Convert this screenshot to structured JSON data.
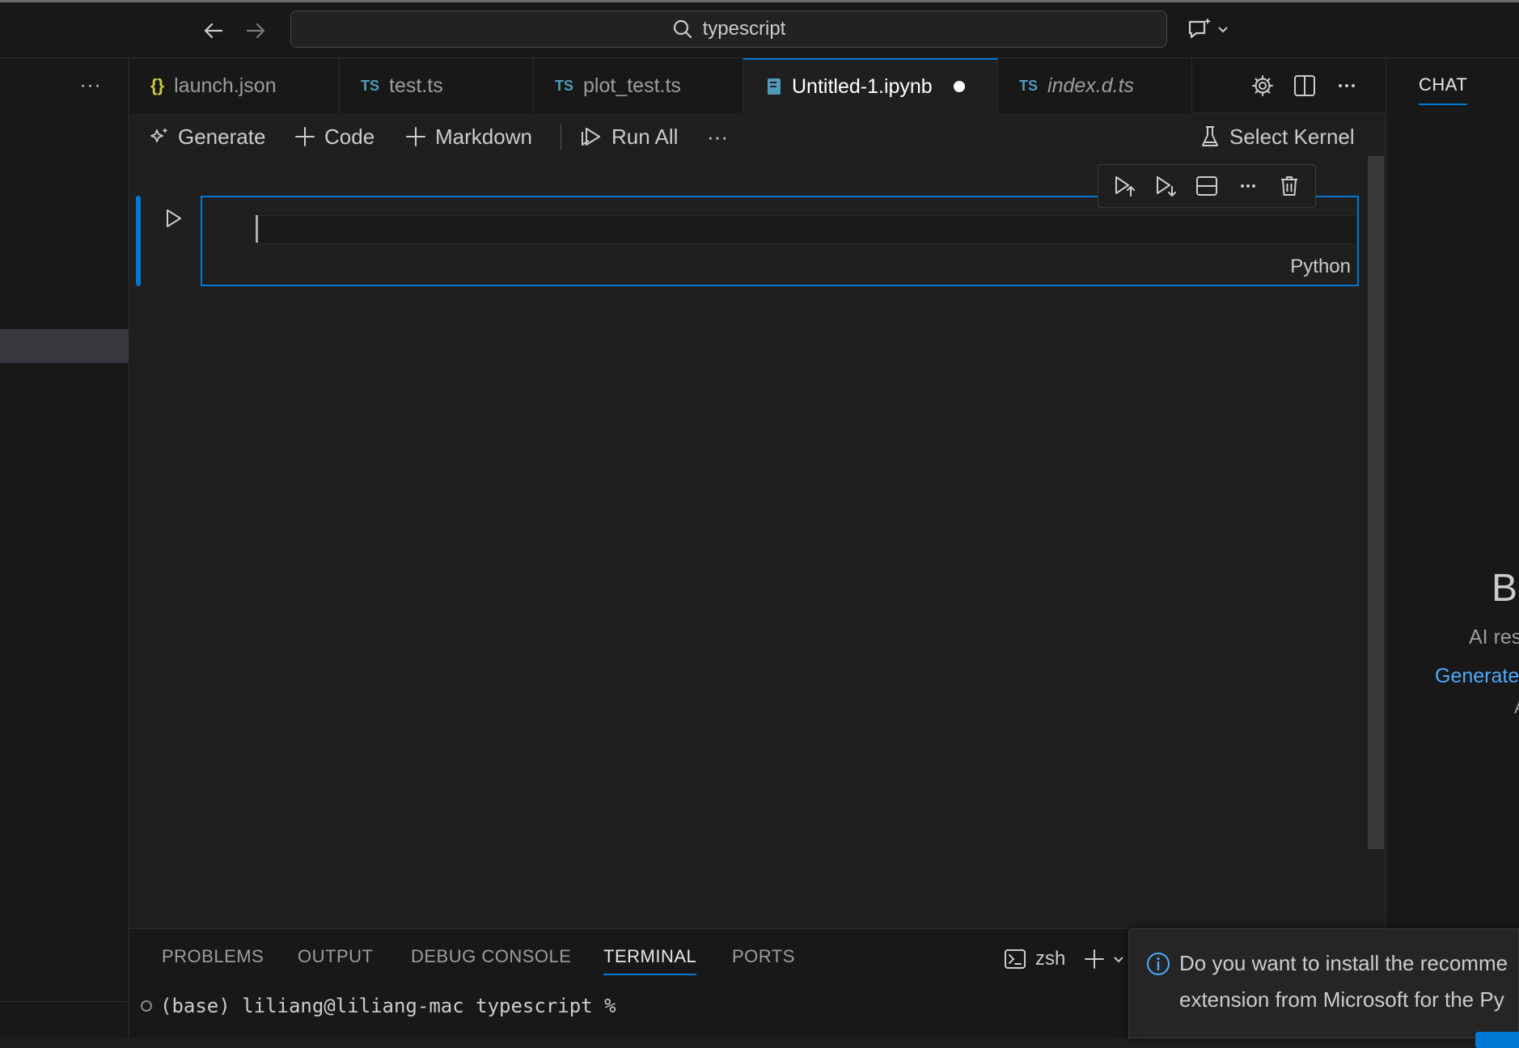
{
  "titlebar": {
    "search_text": "typescript"
  },
  "tabs": [
    {
      "icon": "{}",
      "label": "launch.json",
      "italic": false
    },
    {
      "icon": "TS",
      "label": "test.ts",
      "italic": false
    },
    {
      "icon": "TS",
      "label": "plot_test.ts",
      "italic": false
    },
    {
      "icon": "notebook-icon",
      "label": "Untitled-1.ipynb",
      "italic": false,
      "active": true,
      "dirty": true
    },
    {
      "icon": "TS",
      "label": "index.d.ts",
      "italic": true
    }
  ],
  "notebook_toolbar": {
    "generate": "Generate",
    "code": "Code",
    "markdown": "Markdown",
    "run_all": "Run All",
    "more": "···",
    "select_kernel": "Select Kernel"
  },
  "cell": {
    "language": "Python",
    "content": ""
  },
  "chat": {
    "tab_label": "CHAT",
    "heading": "B",
    "subtext": "AI res",
    "link": "Generate",
    "fragment": "A"
  },
  "panel": {
    "tabs": [
      "PROBLEMS",
      "OUTPUT",
      "DEBUG CONSOLE",
      "TERMINAL",
      "PORTS"
    ],
    "active_tab": "TERMINAL",
    "shell": "zsh",
    "terminal_line": "(base) liliang@liliang-mac typescript %"
  },
  "notification": {
    "line1": "Do you want to install the recomme",
    "line2": "extension from Microsoft for the Py"
  },
  "sidebar": {
    "more": "···"
  },
  "colors": {
    "accent": "#0078d4",
    "background": "#1f1f1f",
    "chrome": "#181818",
    "link": "#4daafc"
  }
}
